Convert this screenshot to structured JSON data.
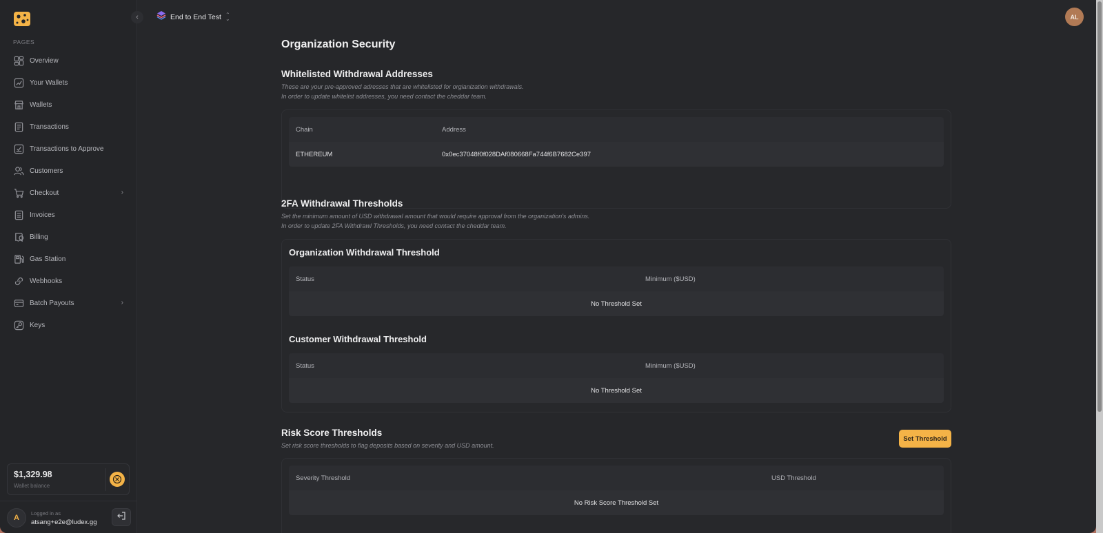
{
  "brand": {
    "accent": "#f4b347"
  },
  "sidebar": {
    "section_label": "PAGES",
    "items": [
      {
        "label": "Overview",
        "icon": "grid-icon"
      },
      {
        "label": "Your Wallets",
        "icon": "chart-icon"
      },
      {
        "label": "Wallets",
        "icon": "store-icon"
      },
      {
        "label": "Transactions",
        "icon": "document-icon"
      },
      {
        "label": "Transactions to Approve",
        "icon": "approve-icon"
      },
      {
        "label": "Customers",
        "icon": "users-icon"
      },
      {
        "label": "Checkout",
        "icon": "cart-icon"
      },
      {
        "label": "Invoices",
        "icon": "invoice-icon"
      },
      {
        "label": "Billing",
        "icon": "wallet-icon"
      },
      {
        "label": "Gas Station",
        "icon": "gas-icon"
      },
      {
        "label": "Webhooks",
        "icon": "link-icon"
      },
      {
        "label": "Batch Payouts",
        "icon": "card-icon"
      },
      {
        "label": "Keys",
        "icon": "key-icon"
      }
    ],
    "balance": {
      "amount": "$1,329.98",
      "label": "Wallet balance"
    },
    "user": {
      "initial": "A",
      "logged_label": "Logged in as",
      "email": "atsang+e2e@ludex.gg"
    }
  },
  "topbar": {
    "org_name": "End to End Test",
    "avatar_initials": "AL"
  },
  "page": {
    "title": "Organization Security",
    "whitelist": {
      "title": "Whitelisted Withdrawal Addresses",
      "desc_line1": "These are your pre-approved adresses that are whitelisted for orgianization withdrawals.",
      "desc_line2": "In order to update whitelist addresses, you need contact the cheddar team.",
      "columns": [
        "Chain",
        "Address"
      ],
      "rows": [
        {
          "chain": "ETHEREUM",
          "address": "0x0ec37048f0f028DAf080668Fa744f6B7682Ce397"
        }
      ]
    },
    "twofa": {
      "title": "2FA Withdrawal Thresholds",
      "desc_line1": "Set the minimum amount of USD withdrawal amount that would require approval from the organization's admins.",
      "desc_line2": "In order to update 2FA Withdrawl Thresholds, you need contact the cheddar team.",
      "org": {
        "title": "Organization Withdrawal Threshold",
        "columns": [
          "Status",
          "Minimum ($USD)"
        ],
        "empty": "No Threshold Set"
      },
      "customer": {
        "title": "Customer Withdrawal Threshold",
        "columns": [
          "Status",
          "Minimum ($USD)"
        ],
        "empty": "No Threshold Set"
      }
    },
    "risk": {
      "title": "Risk Score Thresholds",
      "desc": "Set risk score thresholds to flag deposits based on severity and USD amount.",
      "button": "Set Threshold",
      "columns": [
        "Severity Threshold",
        "USD Threshold"
      ],
      "empty": "No Risk Score Threshold Set"
    }
  }
}
